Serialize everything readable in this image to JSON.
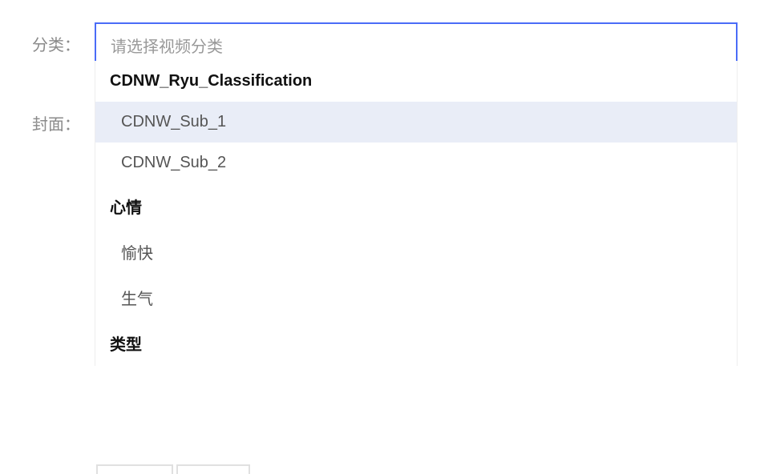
{
  "form": {
    "category_label": "分类：",
    "cover_label": "封面：",
    "category_placeholder": "请选择视频分类"
  },
  "dropdown": {
    "groups": [
      {
        "header": "CDNW_Ryu_Classification",
        "options": [
          {
            "label": "CDNW_Sub_1",
            "hovered": true
          },
          {
            "label": "CDNW_Sub_2",
            "hovered": false
          }
        ]
      },
      {
        "header": "心情",
        "options": [
          {
            "label": "愉快",
            "hovered": false
          },
          {
            "label": "生气",
            "hovered": false
          }
        ]
      },
      {
        "header": "类型",
        "options": []
      }
    ]
  }
}
